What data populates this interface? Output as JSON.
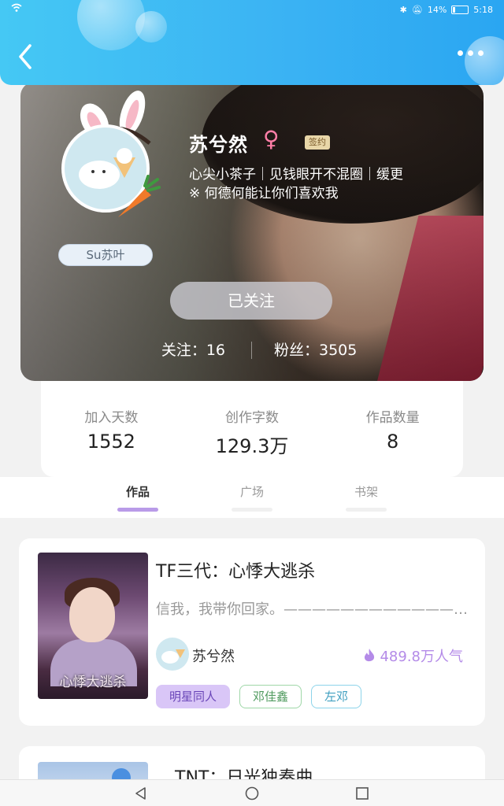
{
  "status_bar": {
    "battery": "14%",
    "time": "5:18"
  },
  "profile": {
    "nickname_pill": "Su苏叶",
    "name": "苏兮然",
    "gender_symbol": "♀",
    "badge": "签约",
    "bio_line1": "心尖小茶子｜见钱眼开不混圈｜缓更",
    "bio_line2": "※ 何德何能让你们喜欢我",
    "follow_button": "已关注",
    "following": "关注：16",
    "fans": "粉丝：3505"
  },
  "stats": [
    {
      "label": "加入天数",
      "value": "1552"
    },
    {
      "label": "创作字数",
      "value": "129.3万"
    },
    {
      "label": "作品数量",
      "value": "8"
    }
  ],
  "tabs": [
    {
      "label": "作品",
      "active": true
    },
    {
      "label": "广场",
      "active": false
    },
    {
      "label": "书架",
      "active": false
    }
  ],
  "works": [
    {
      "title": "TF三代：心悸大逃杀",
      "description": "信我，我带你回家。——————————————",
      "cover_text": "心悸大逃杀",
      "author": "苏兮然",
      "popularity": "489.8万人气",
      "tags": [
        "明星同人",
        "邓佳鑫",
        "左邓"
      ]
    },
    {
      "title": "TNT：日光独奏曲"
    }
  ],
  "colors": {
    "header": "#3bb3f3",
    "accent": "#b99be8"
  }
}
